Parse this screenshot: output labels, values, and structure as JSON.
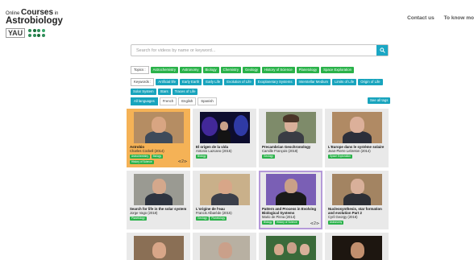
{
  "header": {
    "logo_line1_small": "Online",
    "logo_line1_big": "Courses",
    "logo_line1_in": "in",
    "logo_line2": "Astrobiology",
    "logo_mark_text": "YAU",
    "nav": [
      "Contact us",
      "To know mo"
    ]
  },
  "search": {
    "placeholder": "Search for videos by name or keyword..."
  },
  "topics": {
    "label": "Topics :",
    "tags": [
      "Astrochemistry",
      "Astronomy",
      "Biology",
      "Chemistry",
      "Geology",
      "History of Science",
      "Planetology",
      "Space Exploration"
    ]
  },
  "keywords": {
    "label": "Keywords :",
    "tags": [
      "Artificial life",
      "Early Earth",
      "Early Life",
      "Evolution of Life",
      "Exoplanetary Systems",
      "Interstellar Medium",
      "Limits of Life",
      "Origin of Life",
      "Solar System",
      "Stars",
      "Traces of Life"
    ]
  },
  "languages": [
    "All languages",
    "French",
    "English",
    "Spanish"
  ],
  "see_all_tags": "See all tags",
  "cards": [
    {
      "title": "Astrobio",
      "subtitle": "Charles Cockell (2014)",
      "tags": [
        "Astrochemistry",
        "Biology",
        "History of Science"
      ],
      "expand": "⊲ 2 ⊳"
    },
    {
      "title": "El origen de la vida",
      "subtitle": "Antonio Lazcano (2015)",
      "tags": [
        "Biology"
      ]
    },
    {
      "title": "Precambrian Geochronology",
      "subtitle": "Camille François (2018)",
      "tags": [
        "Geology"
      ]
    },
    {
      "title": "L'Europe dans le système solaire",
      "subtitle": "Jean-Pierre Lebreton (2014)",
      "tags": [
        "Space Exploration"
      ]
    },
    {
      "title": "Search for life in the solar system",
      "subtitle": "Jorge Vago (2018)",
      "tags": [
        "Planetology"
      ]
    },
    {
      "title": "L'origine de l'eau",
      "subtitle": "Francis Albarède (2015)",
      "tags": [
        "Geology",
        "Planetology"
      ]
    },
    {
      "title": "Pattern and Process in Evolving Biological Systems",
      "subtitle": "Mario de Pinna (2014)",
      "tags": [
        "Biology",
        "History of Science"
      ],
      "expand": "⊲ 2 ⊳"
    },
    {
      "title": "Nucleosynthesis, star formation and evolution Part 2",
      "subtitle": "Cyril Georgy (2016)",
      "tags": [
        "Astronomy"
      ]
    }
  ],
  "colors": {
    "green_tag": "#2ab24a",
    "teal_accent": "#18a4bd",
    "highlight_card": "#f5b256"
  }
}
